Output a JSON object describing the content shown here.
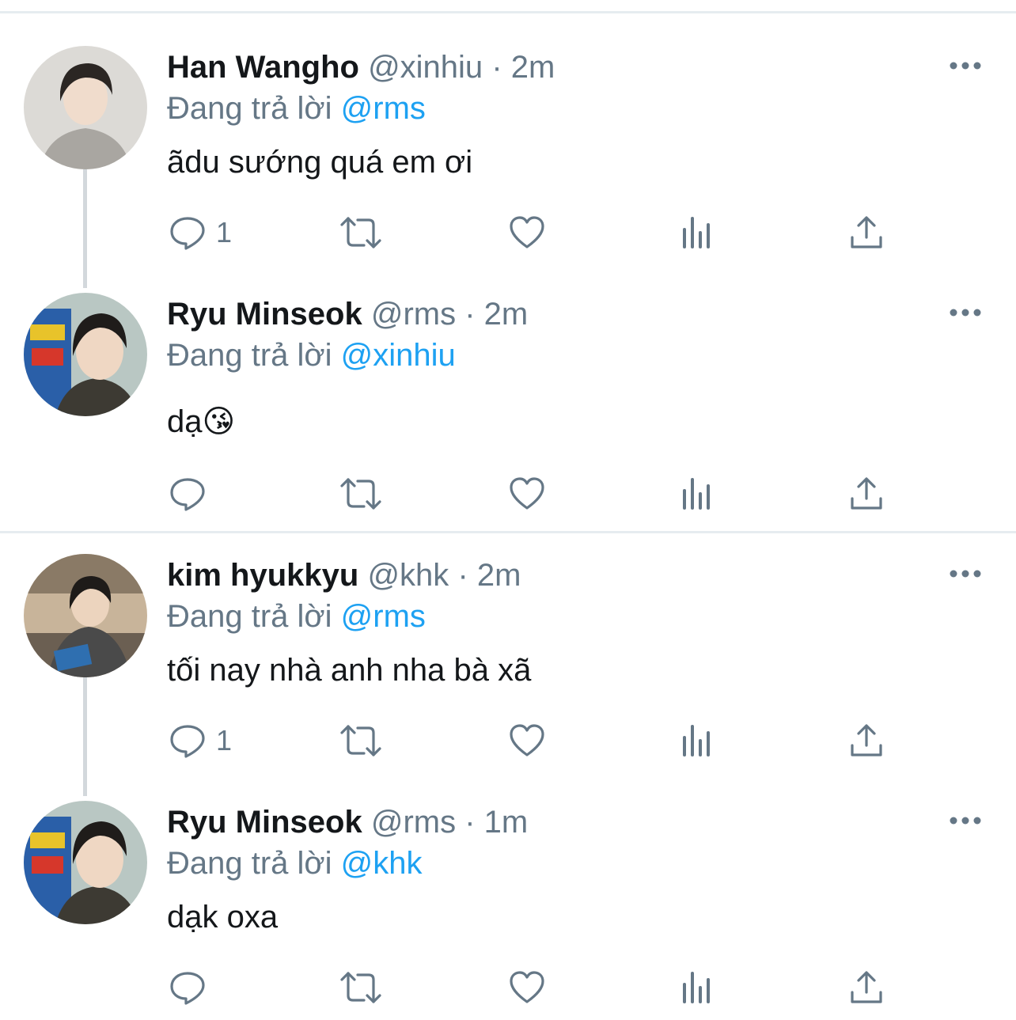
{
  "tweets": [
    {
      "name": "Han Wangho",
      "handle": "@xinhiu",
      "sep": "·",
      "time": "2m",
      "replying_prefix": "Đang trả lời",
      "replying_to": "@rms",
      "text": "ãdu sướng quá em ơi",
      "reply_count": "1",
      "avatar_icon": "avatar-photo"
    },
    {
      "name": "Ryu Minseok",
      "handle": "@rms",
      "sep": "·",
      "time": "2m",
      "replying_prefix": "Đang trả lời",
      "replying_to": "@xinhiu",
      "text": "dạ😘",
      "reply_count": "",
      "avatar_icon": "avatar-photo"
    },
    {
      "name": "kim hyukkyu",
      "handle": "@khk",
      "sep": "·",
      "time": "2m",
      "replying_prefix": "Đang trả lời",
      "replying_to": "@rms",
      "text": "tối nay nhà anh nha bà xã",
      "reply_count": "1",
      "avatar_icon": "avatar-photo"
    },
    {
      "name": "Ryu Minseok",
      "handle": "@rms",
      "sep": "·",
      "time": "1m",
      "replying_prefix": "Đang trả lời",
      "replying_to": "@khk",
      "text": "dạk oxa",
      "reply_count": "",
      "avatar_icon": "avatar-photo"
    }
  ],
  "icons": {
    "reply": "reply-icon",
    "retweet": "retweet-icon",
    "like": "heart-icon",
    "analytics": "analytics-icon",
    "share": "share-icon",
    "more": "more-icon"
  },
  "colors": {
    "accent": "#1da1f2",
    "muted": "#657786",
    "text": "#14171a",
    "divider": "#e6ecf0"
  }
}
